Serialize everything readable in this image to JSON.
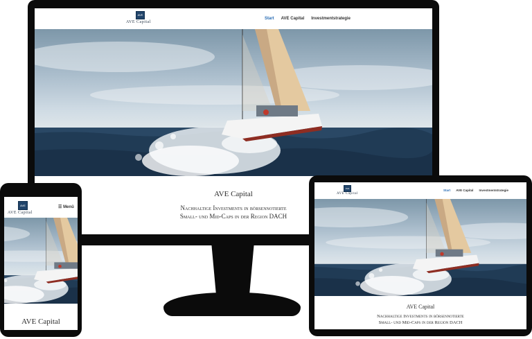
{
  "site": {
    "logo_mark": "AVE",
    "logo_name": "AVE Capital",
    "nav": [
      "Start",
      "AVE Capital",
      "Investmentstrategie"
    ],
    "active_nav": "Start",
    "mobile_menu_label": "Menü",
    "mobile_menu_icon": "hamburger-icon"
  },
  "hero": {
    "title": "AVE Capital",
    "subtitle_line1": "Nachhaltige Investments in börsennotierte",
    "subtitle_line2": "Small- und Mid-Caps in der Region DACH"
  },
  "colors": {
    "accent": "#2a6db5",
    "logo_bg": "#22456b",
    "device": "#0b0b0b"
  }
}
